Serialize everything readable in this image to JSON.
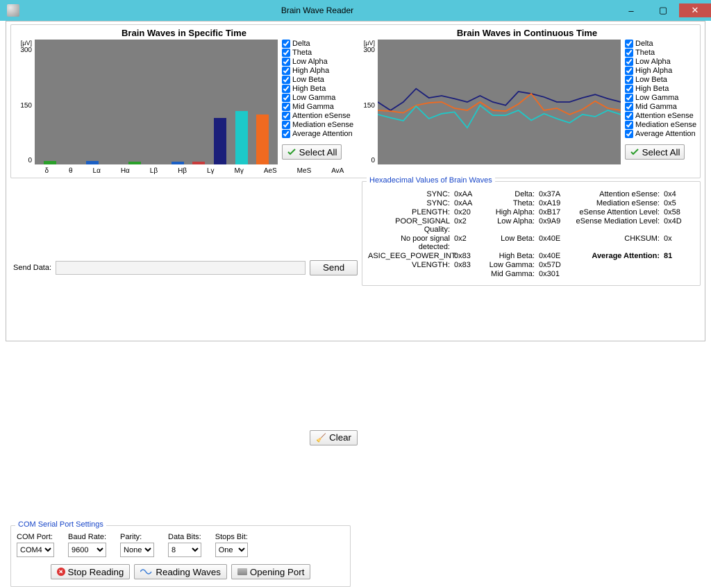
{
  "window": {
    "title": "Brain Wave Reader"
  },
  "chart_data": [
    {
      "type": "bar",
      "title": "Brain Waves in Specific Time",
      "y_unit": "[μV]",
      "ylim": [
        0,
        300
      ],
      "yticks": [
        0,
        150,
        300
      ],
      "categories": [
        "δ",
        "θ",
        "Lα",
        "Hα",
        "Lβ",
        "Hβ",
        "Lγ",
        "Mγ",
        "AeS",
        "MeS",
        "AvA"
      ],
      "values": [
        9,
        0,
        8,
        0,
        6,
        0,
        6,
        6,
        112,
        128,
        120
      ],
      "colors": [
        "#2aa02a",
        "#f7e14b",
        "#1b5fc4",
        "#c83c3c",
        "#2aa02a",
        "#f7e14b",
        "#1b5fc4",
        "#c83c3c",
        "#1b1f7a",
        "#1dc9c9",
        "#f06a20"
      ]
    },
    {
      "type": "line",
      "title": "Brain Waves in Continuous Time",
      "y_unit": "[μV]",
      "ylim": [
        0,
        300
      ],
      "yticks": [
        0,
        150,
        300
      ],
      "x": [
        0,
        1,
        2,
        3,
        4,
        5,
        6,
        7,
        8,
        9,
        10,
        11,
        12,
        13,
        14,
        15,
        16,
        17,
        18,
        19
      ],
      "series": [
        {
          "name": "Attention eSense",
          "color": "#1b1f7a",
          "values": [
            150,
            130,
            150,
            182,
            160,
            165,
            158,
            150,
            165,
            150,
            142,
            175,
            170,
            162,
            150,
            150,
            160,
            168,
            158,
            150
          ]
        },
        {
          "name": "Mediation eSense",
          "color": "#f06a20",
          "values": [
            130,
            128,
            124,
            142,
            148,
            150,
            135,
            130,
            150,
            130,
            128,
            145,
            170,
            130,
            135,
            120,
            132,
            152,
            135,
            130
          ]
        },
        {
          "name": "Average Attention",
          "color": "#1dc9c9",
          "values": [
            120,
            112,
            105,
            140,
            110,
            122,
            126,
            88,
            142,
            118,
            118,
            130,
            106,
            122,
            110,
            100,
            120,
            115,
            130,
            120
          ]
        }
      ]
    }
  ],
  "legend_items": [
    "Delta",
    "Theta",
    "Low Alpha",
    "High Alpha",
    "Low Beta",
    "High Beta",
    "Low Gamma",
    "Mid Gamma",
    "Attention eSense",
    "Mediation eSense",
    "Average Attention"
  ],
  "select_all_label": "Select All",
  "send": {
    "label": "Send Data:",
    "value": "",
    "send_btn": "Send",
    "clear_btn": "Clear"
  },
  "serial": {
    "title": "COM Serial Port Settings",
    "com_label": "COM Port:",
    "com_value": "COM4",
    "baud_label": "Baud Rate:",
    "baud_value": "9600",
    "parity_label": "Parity:",
    "parity_value": "None",
    "databits_label": "Data Bits:",
    "databits_value": "8",
    "stopbits_label": "Stops Bit:",
    "stopbits_value": "One"
  },
  "buttons": {
    "stop": "Stop Reading",
    "reading": "Reading Waves",
    "opening": "Opening Port"
  },
  "hex": {
    "title": "Hexadecimal Values of Brain Waves",
    "rows_left": [
      [
        "SYNC:",
        "0xAA"
      ],
      [
        "SYNC:",
        "0xAA"
      ],
      [
        "PLENGTH:",
        "0x20"
      ],
      [
        "POOR_SIGNAL Quality:",
        "0x2"
      ],
      [
        "No poor signal detected:",
        "0x2"
      ],
      [
        "ASIC_EEG_POWER_INT:",
        "0x83"
      ],
      [
        "VLENGTH:",
        "0x83"
      ]
    ],
    "rows_mid": [
      [
        "Delta:",
        "0x37A"
      ],
      [
        "Theta:",
        "0xA19"
      ],
      [
        "High Alpha:",
        "0xB17"
      ],
      [
        "Low Alpha:",
        "0x9A9"
      ],
      [
        "Low Beta:",
        "0x40E"
      ],
      [
        "High Beta:",
        "0x40E"
      ],
      [
        "Low Gamma:",
        "0x57D"
      ],
      [
        "Mid Gamma:",
        "0x301"
      ]
    ],
    "rows_right": [
      [
        "Attention eSense:",
        "0x4"
      ],
      [
        "Mediation eSense:",
        "0x5"
      ],
      [
        "eSense Attention Level:",
        "0x58"
      ],
      [
        "eSense Mediation Level:",
        "0x4D"
      ],
      [
        "CHKSUM:",
        "0x"
      ]
    ],
    "avg_label": "Average Attention:",
    "avg_value": "81"
  }
}
